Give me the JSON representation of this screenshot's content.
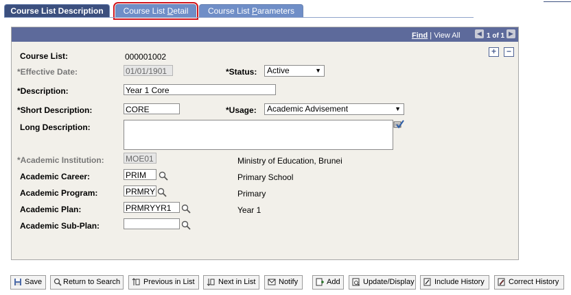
{
  "tabs": [
    {
      "label": "Course List Description",
      "active": true
    },
    {
      "label_pre": "Course List ",
      "label_key": "D",
      "label_post": "etail",
      "selected_highlight": true
    },
    {
      "label_pre": "Course List ",
      "label_key": "P",
      "label_post": "arameters"
    }
  ],
  "nav": {
    "find": "Find",
    "sep": " | ",
    "view_all": "View All",
    "count": "1 of 1"
  },
  "form": {
    "course_list": {
      "label": "Course List:",
      "value": "000001002"
    },
    "effective_date": {
      "label": "*Effective Date:",
      "value": "01/01/1901"
    },
    "status": {
      "label": "*Status:",
      "value": "Active"
    },
    "description": {
      "label": "*Description:",
      "value": "Year 1 Core"
    },
    "short_description": {
      "label": "*Short Description:",
      "value": "CORE"
    },
    "usage": {
      "label": "*Usage:",
      "value": "Academic Advisement"
    },
    "long_description": {
      "label": "Long Description:",
      "value": ""
    },
    "academic_institution": {
      "label": "*Academic Institution:",
      "value": "MOE01",
      "desc": "Ministry of Education, Brunei"
    },
    "academic_career": {
      "label": "Academic Career:",
      "value": "PRIM",
      "desc": "Primary School"
    },
    "academic_program": {
      "label": "Academic Program:",
      "value": "PRMRY",
      "desc": "Primary"
    },
    "academic_plan": {
      "label": "Academic Plan:",
      "value": "PRMRYYR1",
      "desc": "Year 1"
    },
    "academic_subplan": {
      "label": "Academic Sub-Plan:",
      "value": "",
      "desc": ""
    }
  },
  "toolbar": {
    "save": "Save",
    "return_to_search": "Return to Search",
    "previous_in_list": "Previous in List",
    "next_in_list": "Next in List",
    "notify": "Notify",
    "add": "Add",
    "update_display": "Update/Display",
    "include_history": "Include History",
    "correct_history": "Correct History"
  },
  "colors": {
    "tab_active": "#3b4f7e",
    "tab_inactive": "#6f8ec7",
    "panel_header": "#5d6a9b",
    "highlight": "#d0141b"
  }
}
